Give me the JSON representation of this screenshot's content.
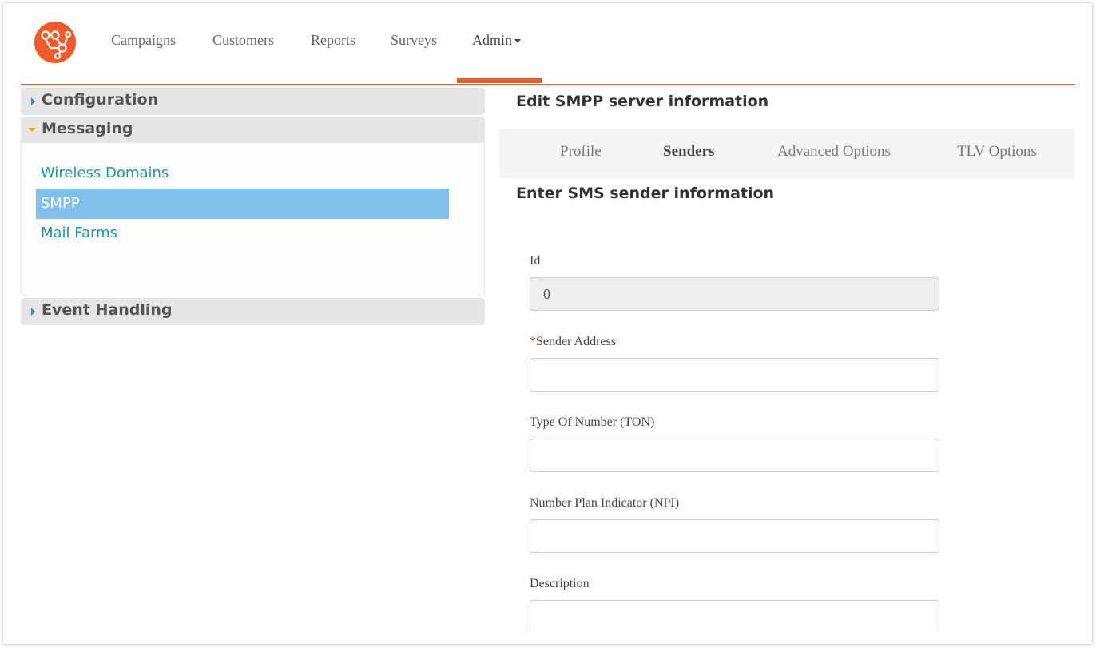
{
  "nav": {
    "items": [
      "Campaigns",
      "Customers",
      "Reports",
      "Surveys"
    ],
    "admin_label": "Admin",
    "accent_color": "#ee5a2a"
  },
  "sidebar": {
    "configuration_label": "Configuration",
    "messaging_label": "Messaging",
    "messaging_items": [
      "Wireless Domains",
      "SMPP",
      "Mail Farms"
    ],
    "selected_item": "SMPP",
    "event_handling_label": "Event Handling"
  },
  "main": {
    "title": "Edit SMPP server information",
    "tabs": [
      "Profile",
      "Senders",
      "Advanced Options",
      "TLV Options"
    ],
    "active_tab": "Senders",
    "subtitle": "Enter SMS sender information",
    "fields": {
      "id": {
        "label": "Id",
        "value": "0"
      },
      "sender_address": {
        "required_mark": "*",
        "label": "Sender Address",
        "value": ""
      },
      "ton": {
        "label": "Type Of Number (TON)",
        "value": ""
      },
      "npi": {
        "label": "Number Plan Indicator (NPI)",
        "value": ""
      },
      "description": {
        "label": "Description",
        "value": ""
      }
    }
  }
}
